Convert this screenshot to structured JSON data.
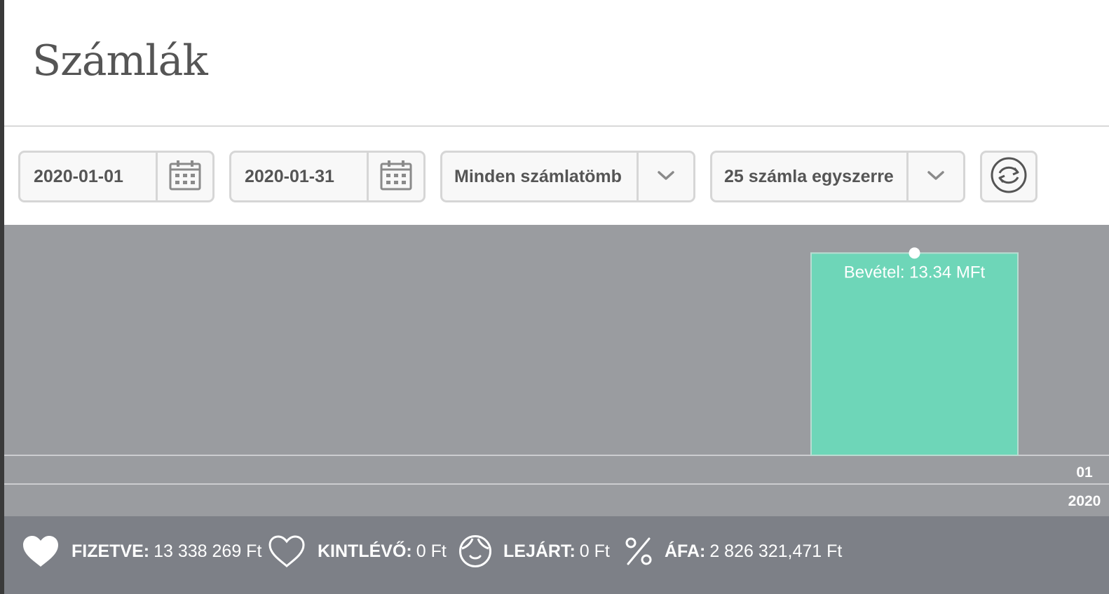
{
  "page": {
    "title": "Számlák"
  },
  "filters": {
    "date_from": "2020-01-01",
    "date_to": "2020-01-31",
    "invoice_block": "Minden számlatömb",
    "page_size": "25 számla egyszerre"
  },
  "icons": {
    "date_from_button": "calendar-icon",
    "date_to_button": "calendar-icon",
    "block_dropdown": "chevron-down-icon",
    "page_size_dropdown": "chevron-down-icon",
    "refresh": "refresh-icon",
    "paid": "heart-filled-icon",
    "outstanding": "heart-outline-icon",
    "overdue": "face-icon",
    "vat": "percent-icon"
  },
  "chart_data": {
    "type": "bar",
    "categories": [
      "01"
    ],
    "category_group": "2020",
    "series": [
      {
        "name": "Bevétel",
        "values": [
          13.34
        ]
      }
    ],
    "data_labels": [
      "Bevétel: 13.34 MFt"
    ],
    "unit": "MFt",
    "ylim": [
      0,
      15.2
    ],
    "grid": false,
    "colors": {
      "bar": "#6ed6b8",
      "background": "#9a9ca0",
      "axis_text": "#ffffff"
    }
  },
  "summary": {
    "paid_label": "FIZETVE:",
    "paid_value": "13 338 269 Ft",
    "outstanding_label": "KINTLÉVŐ:",
    "outstanding_value": "0 Ft",
    "overdue_label": "LEJÁRT:",
    "overdue_value": "0 Ft",
    "vat_label": "ÁFA:",
    "vat_value": "2 826 321,471 Ft"
  },
  "colors": {
    "title_text": "#555555",
    "control_border": "#d6d6d6",
    "control_text": "#555555",
    "chart_background": "#9a9ca0",
    "summary_background": "#7d8087",
    "accent_bar": "#6ed6b8"
  }
}
